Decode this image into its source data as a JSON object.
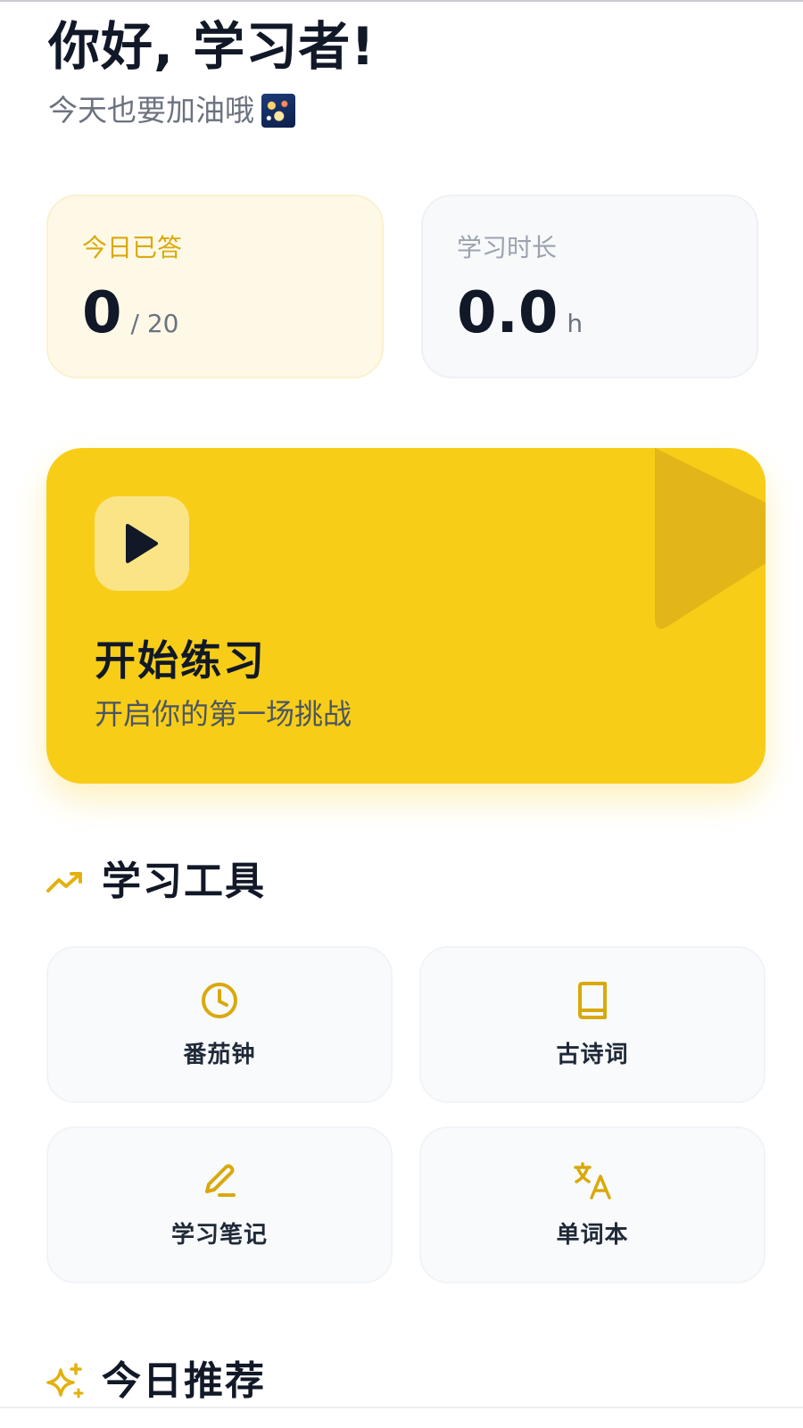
{
  "header": {
    "greeting": "你好, 学习者!",
    "subtitle": "今天也要加油哦"
  },
  "stats": {
    "answered": {
      "label": "今日已答",
      "value": "0",
      "suffix": "/ 20"
    },
    "duration": {
      "label": "学习时长",
      "value": "0.0",
      "suffix": "h"
    }
  },
  "practice": {
    "title": "开始练习",
    "subtitle": "开启你的第一场挑战"
  },
  "tools": {
    "title": "学习工具",
    "items": [
      {
        "label": "番茄钟",
        "icon": "clock-icon"
      },
      {
        "label": "古诗词",
        "icon": "book-icon"
      },
      {
        "label": "学习笔记",
        "icon": "pencil-icon"
      },
      {
        "label": "单词本",
        "icon": "translate-icon"
      }
    ]
  },
  "recommend": {
    "title": "今日推荐"
  },
  "colors": {
    "accent": "#f7cd17",
    "accent_text": "#d9a90c",
    "background": "#ffffff"
  }
}
